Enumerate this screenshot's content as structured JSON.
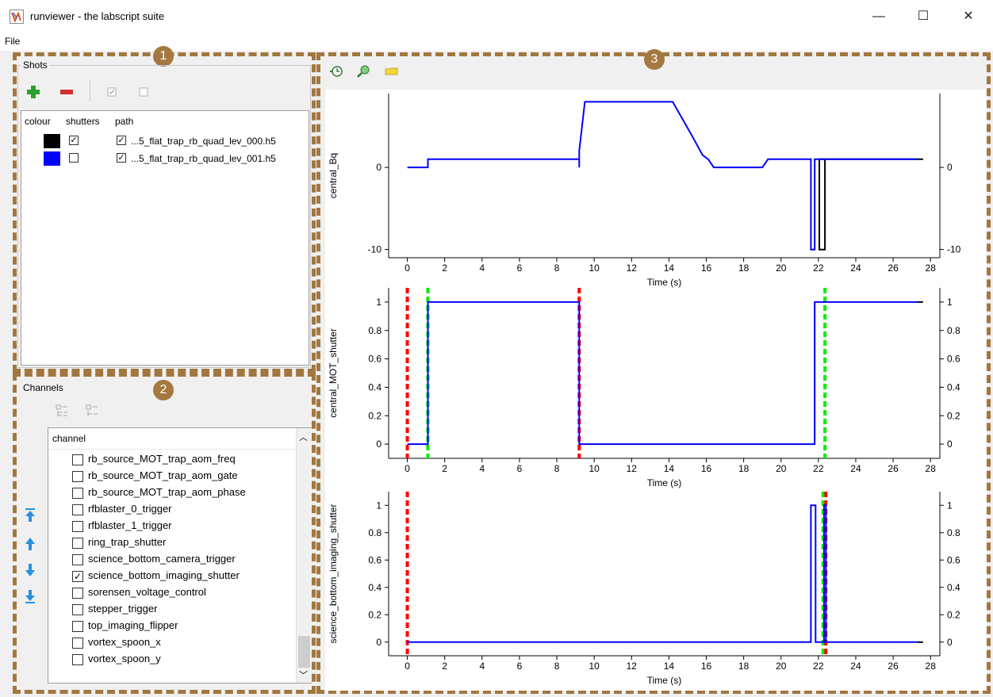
{
  "window": {
    "title": "runviewer - the labscript suite",
    "minimize": "—",
    "maximize": "☐",
    "close": "✕"
  },
  "menu": {
    "file": "File"
  },
  "annotations": {
    "badge1": "1",
    "badge2": "2",
    "badge3": "3"
  },
  "shots": {
    "label": "Shots",
    "columns": [
      "colour",
      "shutters",
      "path"
    ],
    "rows": [
      {
        "colour": "#000000",
        "shutters": true,
        "path_checked": true,
        "path": "...5_flat_trap_rb_quad_lev_000.h5"
      },
      {
        "colour": "#0000ff",
        "shutters": false,
        "path_checked": true,
        "path": "...5_flat_trap_rb_quad_lev_001.h5"
      }
    ]
  },
  "channels": {
    "label": "Channels",
    "header": "channel",
    "items": [
      {
        "name": "rb_source_MOT_trap_aom_freq",
        "checked": false
      },
      {
        "name": "rb_source_MOT_trap_aom_gate",
        "checked": false
      },
      {
        "name": "rb_source_MOT_trap_aom_phase",
        "checked": false
      },
      {
        "name": "rfblaster_0_trigger",
        "checked": false
      },
      {
        "name": "rfblaster_1_trigger",
        "checked": false
      },
      {
        "name": "ring_trap_shutter",
        "checked": false
      },
      {
        "name": "science_bottom_camera_trigger",
        "checked": false
      },
      {
        "name": "science_bottom_imaging_shutter",
        "checked": true
      },
      {
        "name": "sorensen_voltage_control",
        "checked": false
      },
      {
        "name": "stepper_trigger",
        "checked": false
      },
      {
        "name": "top_imaging_flipper",
        "checked": false
      },
      {
        "name": "vortex_spoon_x",
        "checked": false
      },
      {
        "name": "vortex_spoon_y",
        "checked": false
      }
    ]
  },
  "plots": {
    "xlabel": "Time (s)",
    "xticks": [
      0,
      2,
      4,
      6,
      8,
      10,
      12,
      14,
      16,
      18,
      20,
      22,
      24,
      26,
      28
    ]
  },
  "chart_data": [
    {
      "type": "line",
      "ylabel": "central_Bq",
      "xlabel": "Time (s)",
      "xlim": [
        -1,
        28.5
      ],
      "ylim": [
        -11,
        9
      ],
      "yticks": [
        0,
        -10
      ],
      "series": [
        {
          "color": "#000000",
          "points": [
            [
              27.3,
              1
            ],
            [
              27.6,
              1
            ],
            [
              22.05,
              1
            ],
            [
              22.05,
              -10
            ],
            [
              22.35,
              -10
            ],
            [
              22.35,
              1
            ]
          ]
        },
        {
          "color": "#0000ff",
          "points": [
            [
              0,
              0
            ],
            [
              1.1,
              0
            ],
            [
              1.1,
              1
            ],
            [
              9.2,
              1
            ],
            [
              9.2,
              0
            ],
            [
              9.2,
              2
            ],
            [
              9.5,
              8
            ],
            [
              14.2,
              8
            ],
            [
              15.2,
              4
            ],
            [
              15.8,
              1.5
            ],
            [
              16.1,
              1
            ],
            [
              16.4,
              0
            ],
            [
              19.0,
              0
            ],
            [
              19.3,
              1
            ],
            [
              21.6,
              1
            ],
            [
              21.6,
              -10
            ],
            [
              21.8,
              -10
            ],
            [
              21.8,
              1
            ],
            [
              27.3,
              1
            ]
          ]
        }
      ]
    },
    {
      "type": "line",
      "ylabel": "central_MOT_shutter",
      "xlabel": "Time (s)",
      "xlim": [
        -1,
        28.5
      ],
      "ylim": [
        -0.1,
        1.1
      ],
      "yticks": [
        0,
        0.2,
        0.4,
        0.6,
        0.8,
        1
      ],
      "markers": [
        {
          "color": "#ff0000",
          "x": 0
        },
        {
          "color": "#00ee00",
          "x": 1.1
        },
        {
          "color": "#ff0000",
          "x": 9.2
        },
        {
          "color": "#00ee00",
          "x": 22.35
        }
      ],
      "series": [
        {
          "color": "#000000",
          "points": [
            [
              27.3,
              1
            ],
            [
              27.6,
              1
            ]
          ]
        },
        {
          "color": "#0000ff",
          "points": [
            [
              0,
              0
            ],
            [
              1.1,
              0
            ],
            [
              1.1,
              1
            ],
            [
              9.2,
              1
            ],
            [
              9.2,
              0
            ],
            [
              21.8,
              0
            ],
            [
              21.8,
              1
            ],
            [
              27.3,
              1
            ]
          ]
        }
      ]
    },
    {
      "type": "line",
      "ylabel": "science_bottom_imaging_shutter",
      "xlabel": "Time (s)",
      "xlim": [
        -1,
        28.5
      ],
      "ylim": [
        -0.1,
        1.1
      ],
      "yticks": [
        0,
        0.2,
        0.4,
        0.6,
        0.8,
        1
      ],
      "markers": [
        {
          "color": "#ff0000",
          "x": 0
        },
        {
          "color": "#00ee00",
          "x": 22.25
        },
        {
          "color": "#ff0000",
          "x": 22.4
        }
      ],
      "series": [
        {
          "color": "#000000",
          "points": [
            [
              27.3,
              0
            ],
            [
              27.6,
              0
            ]
          ]
        },
        {
          "color": "#0000ff",
          "points": [
            [
              0,
              0
            ],
            [
              21.6,
              0
            ],
            [
              21.6,
              1
            ],
            [
              21.85,
              1
            ],
            [
              21.85,
              0
            ],
            [
              22.3,
              0
            ],
            [
              22.3,
              1
            ],
            [
              22.4,
              1
            ],
            [
              22.4,
              0
            ],
            [
              27.3,
              0
            ]
          ]
        }
      ]
    }
  ]
}
